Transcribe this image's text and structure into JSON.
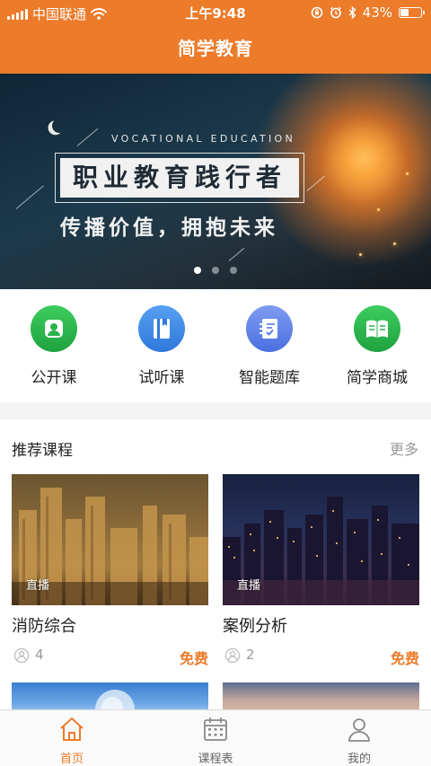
{
  "status_bar": {
    "carrier": "中国联通",
    "time": "上午9:48",
    "battery": "43%",
    "battery_level": 0.43,
    "icons": [
      "signal-icon",
      "wifi-icon",
      "orientation-lock-icon",
      "alarm-icon",
      "bluetooth-icon",
      "battery-icon"
    ]
  },
  "header": {
    "title": "简学教育"
  },
  "banner": {
    "subtitle": "VOCATIONAL EDUCATION",
    "title": "职业教育践行者",
    "slogan": "传播价值，拥抱未来",
    "slide_count": 3,
    "active_slide": 1
  },
  "quick_entries": [
    {
      "label": "公开课",
      "icon": "person-icon",
      "color": "#2bb24c"
    },
    {
      "label": "试听课",
      "icon": "book-icon",
      "color": "#3a86e8"
    },
    {
      "label": "智能题库",
      "icon": "question-bank-icon",
      "color": "#5b7fe8"
    },
    {
      "label": "简学商城",
      "icon": "open-book-icon",
      "color": "#2bb24c"
    }
  ],
  "recommended": {
    "title": "推荐课程",
    "more": "更多",
    "courses": [
      {
        "tag": "直播",
        "title": "消防综合",
        "students": "4",
        "price": "免费"
      },
      {
        "tag": "直播",
        "title": "案例分析",
        "students": "2",
        "price": "免费"
      }
    ]
  },
  "tab_bar": {
    "items": [
      {
        "label": "首页",
        "icon": "home-icon",
        "active": true
      },
      {
        "label": "课程表",
        "icon": "calendar-icon",
        "active": false
      },
      {
        "label": "我的",
        "icon": "user-icon",
        "active": false
      }
    ]
  },
  "colors": {
    "accent": "#ec7b2a",
    "price": "#ec7b2a",
    "muted": "#999999"
  }
}
